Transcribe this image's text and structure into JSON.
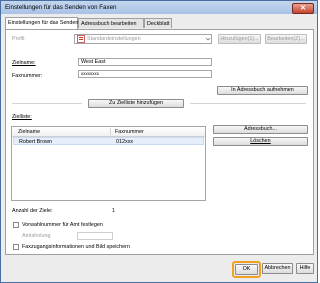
{
  "window": {
    "title": "Einstellungen für das Senden von Faxen",
    "close_glyph": "✕"
  },
  "tabs": [
    {
      "label": "Einstellungen für das Senden"
    },
    {
      "label": "Adressbuch bearbeiten"
    },
    {
      "label": "Deckblatt"
    }
  ],
  "profile": {
    "label": "Profil:",
    "value": "Standardeinstellungen",
    "add_button": "Hinzufügen(1)...",
    "edit_button": "Bearbeiten(Z)..."
  },
  "recipient": {
    "name_label": "Zielname:",
    "name_value": "West East",
    "fax_label": "Faxnummer:",
    "fax_value": "xxxxxxxx",
    "addressbook_add_button": "In Adressbuch aufnehmen",
    "add_to_list_button": "Zu Zielliste hinzufügen"
  },
  "target_list": {
    "label": "Zielliste:",
    "columns": [
      "Zielname",
      "Faxnummer"
    ],
    "rows": [
      {
        "name": "Robert Brown",
        "fax": "012xxx"
      }
    ],
    "addressbook_button": "Adressbuch...",
    "delete_button": "Löschen"
  },
  "count": {
    "label": "Anzahl der Ziele:",
    "value": "1"
  },
  "options": {
    "prefix_label": "Vorwahlnummer für Amt festlegen",
    "prefix_sublabel": "Amtsholung",
    "save_label": "Faxzugangsinformationen und Bild speichern"
  },
  "footer": {
    "ok": "OK",
    "cancel": "Abbrechen",
    "help": "Hilfe"
  },
  "colors": {
    "accent": "#f2a022",
    "titlebar": "#a9c2e6",
    "close": "#c4432d"
  }
}
